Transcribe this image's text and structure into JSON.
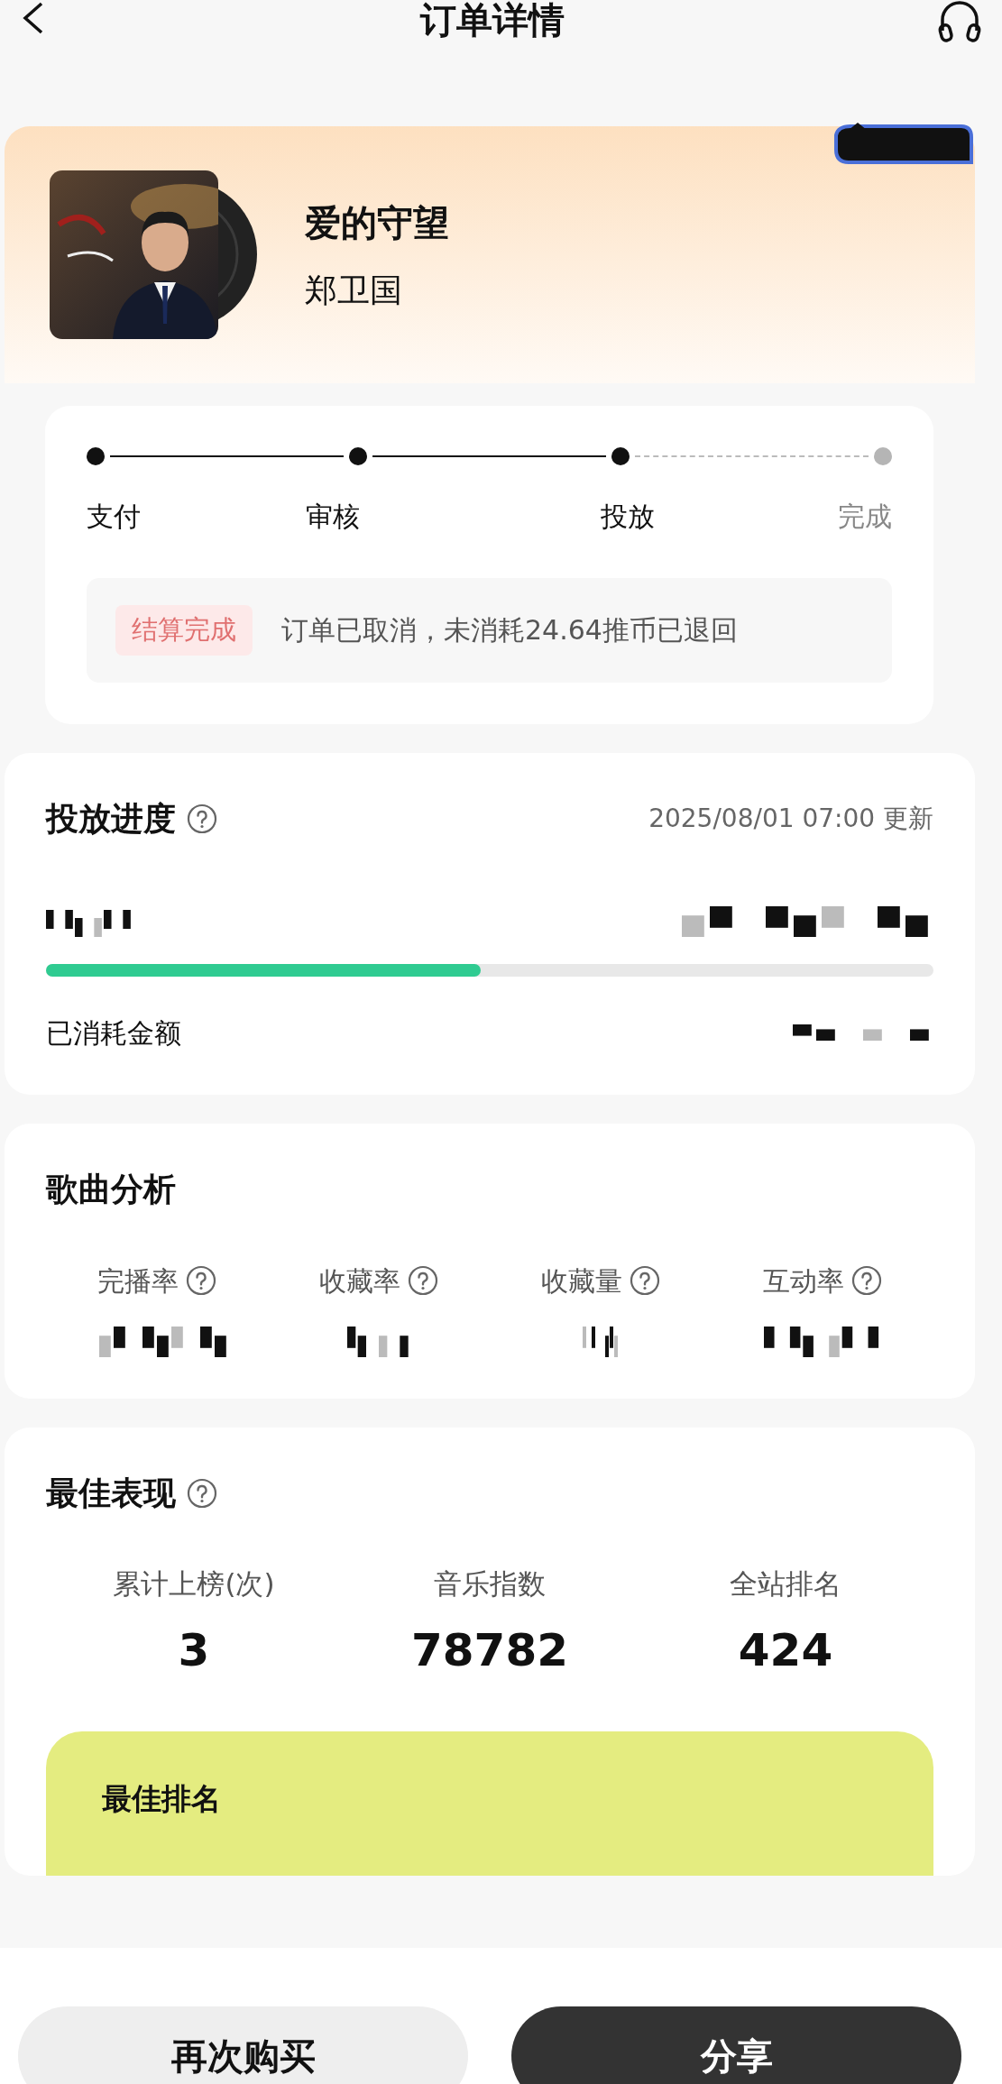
{
  "header": {
    "title": "订单详情"
  },
  "song": {
    "title": "爱的守望",
    "artist": "郑卫国"
  },
  "steps": [
    {
      "label": "支付",
      "done": true
    },
    {
      "label": "审核",
      "done": true
    },
    {
      "label": "投放",
      "done": true
    },
    {
      "label": "完成",
      "done": false
    }
  ],
  "notice": {
    "tag": "结算完成",
    "text": "订单已取消，未消耗24.64推币已退回"
  },
  "delivery": {
    "title": "投放进度",
    "updated": "2025/08/01 07:00 更新",
    "level": 0.49,
    "spent_label": "已消耗金额"
  },
  "analysis": {
    "title": "歌曲分析",
    "metrics": [
      {
        "label": "完播率"
      },
      {
        "label": "收藏率"
      },
      {
        "label": "收藏量"
      },
      {
        "label": "互动率"
      }
    ]
  },
  "best": {
    "title": "最佳表现",
    "stats": [
      {
        "label": "累计上榜(次)",
        "value": "3"
      },
      {
        "label": "音乐指数",
        "value": "78782"
      },
      {
        "label": "全站排名",
        "value": "424"
      }
    ],
    "banner_title": "最佳排名"
  },
  "buttons": [
    {
      "label": "再次购买",
      "kind": "secondary"
    },
    {
      "label": "分享",
      "kind": "primary"
    }
  ]
}
